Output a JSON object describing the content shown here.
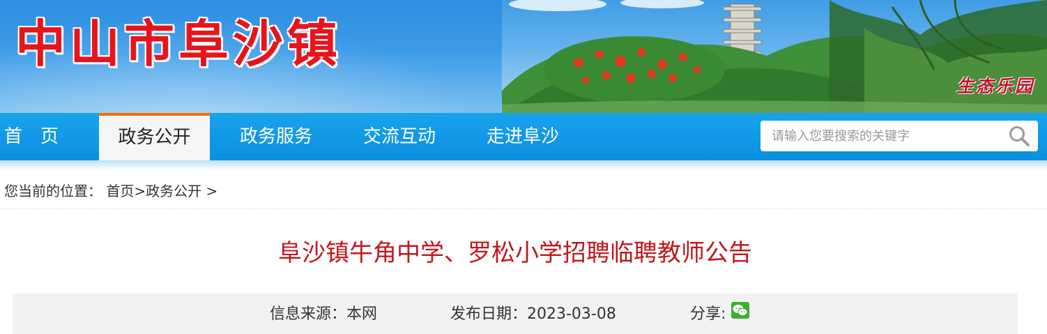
{
  "banner": {
    "title": "中山市阜沙镇",
    "slogan": "生态乐园"
  },
  "nav": {
    "items": [
      {
        "label": "首　页"
      },
      {
        "label": "政务公开"
      },
      {
        "label": "政务服务"
      },
      {
        "label": "交流互动"
      },
      {
        "label": "走进阜沙"
      }
    ],
    "active": "政务公开"
  },
  "search": {
    "placeholder": "请输入您要搜索的关键字",
    "icon": "magnifier-icon"
  },
  "breadcrumb": {
    "prefix": "您当前的位置：",
    "home": "首页",
    "sep": ">",
    "current": "政务公开",
    "trail": ">"
  },
  "article": {
    "title": "阜沙镇牛角中学、罗松小学招聘临聘教师公告",
    "source": "信息来源：本网",
    "date": "发布日期：2023-03-08",
    "share": "分享:",
    "share_icon": "wechat-icon"
  },
  "colors": {
    "nav_blue": "#0b8fe0",
    "title_red": "#c0171d",
    "banner_red": "#e8141b",
    "active_tab_accent": "#ff6a00"
  }
}
